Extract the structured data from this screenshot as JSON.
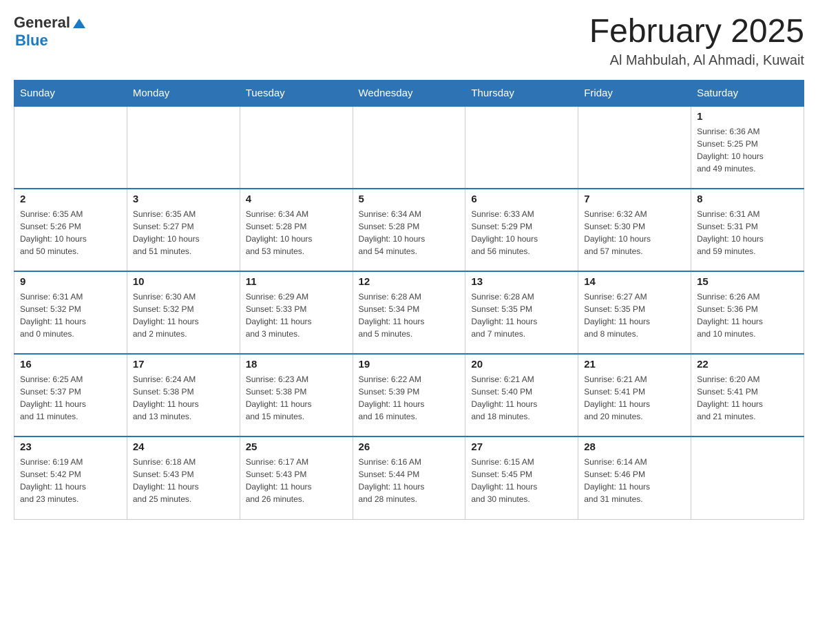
{
  "header": {
    "logo": {
      "general": "General",
      "blue": "Blue"
    },
    "title": "February 2025",
    "location": "Al Mahbulah, Al Ahmadi, Kuwait"
  },
  "days_of_week": [
    "Sunday",
    "Monday",
    "Tuesday",
    "Wednesday",
    "Thursday",
    "Friday",
    "Saturday"
  ],
  "weeks": [
    {
      "days": [
        {
          "number": "",
          "info": ""
        },
        {
          "number": "",
          "info": ""
        },
        {
          "number": "",
          "info": ""
        },
        {
          "number": "",
          "info": ""
        },
        {
          "number": "",
          "info": ""
        },
        {
          "number": "",
          "info": ""
        },
        {
          "number": "1",
          "info": "Sunrise: 6:36 AM\nSunset: 5:25 PM\nDaylight: 10 hours\nand 49 minutes."
        }
      ]
    },
    {
      "days": [
        {
          "number": "2",
          "info": "Sunrise: 6:35 AM\nSunset: 5:26 PM\nDaylight: 10 hours\nand 50 minutes."
        },
        {
          "number": "3",
          "info": "Sunrise: 6:35 AM\nSunset: 5:27 PM\nDaylight: 10 hours\nand 51 minutes."
        },
        {
          "number": "4",
          "info": "Sunrise: 6:34 AM\nSunset: 5:28 PM\nDaylight: 10 hours\nand 53 minutes."
        },
        {
          "number": "5",
          "info": "Sunrise: 6:34 AM\nSunset: 5:28 PM\nDaylight: 10 hours\nand 54 minutes."
        },
        {
          "number": "6",
          "info": "Sunrise: 6:33 AM\nSunset: 5:29 PM\nDaylight: 10 hours\nand 56 minutes."
        },
        {
          "number": "7",
          "info": "Sunrise: 6:32 AM\nSunset: 5:30 PM\nDaylight: 10 hours\nand 57 minutes."
        },
        {
          "number": "8",
          "info": "Sunrise: 6:31 AM\nSunset: 5:31 PM\nDaylight: 10 hours\nand 59 minutes."
        }
      ]
    },
    {
      "days": [
        {
          "number": "9",
          "info": "Sunrise: 6:31 AM\nSunset: 5:32 PM\nDaylight: 11 hours\nand 0 minutes."
        },
        {
          "number": "10",
          "info": "Sunrise: 6:30 AM\nSunset: 5:32 PM\nDaylight: 11 hours\nand 2 minutes."
        },
        {
          "number": "11",
          "info": "Sunrise: 6:29 AM\nSunset: 5:33 PM\nDaylight: 11 hours\nand 3 minutes."
        },
        {
          "number": "12",
          "info": "Sunrise: 6:28 AM\nSunset: 5:34 PM\nDaylight: 11 hours\nand 5 minutes."
        },
        {
          "number": "13",
          "info": "Sunrise: 6:28 AM\nSunset: 5:35 PM\nDaylight: 11 hours\nand 7 minutes."
        },
        {
          "number": "14",
          "info": "Sunrise: 6:27 AM\nSunset: 5:35 PM\nDaylight: 11 hours\nand 8 minutes."
        },
        {
          "number": "15",
          "info": "Sunrise: 6:26 AM\nSunset: 5:36 PM\nDaylight: 11 hours\nand 10 minutes."
        }
      ]
    },
    {
      "days": [
        {
          "number": "16",
          "info": "Sunrise: 6:25 AM\nSunset: 5:37 PM\nDaylight: 11 hours\nand 11 minutes."
        },
        {
          "number": "17",
          "info": "Sunrise: 6:24 AM\nSunset: 5:38 PM\nDaylight: 11 hours\nand 13 minutes."
        },
        {
          "number": "18",
          "info": "Sunrise: 6:23 AM\nSunset: 5:38 PM\nDaylight: 11 hours\nand 15 minutes."
        },
        {
          "number": "19",
          "info": "Sunrise: 6:22 AM\nSunset: 5:39 PM\nDaylight: 11 hours\nand 16 minutes."
        },
        {
          "number": "20",
          "info": "Sunrise: 6:21 AM\nSunset: 5:40 PM\nDaylight: 11 hours\nand 18 minutes."
        },
        {
          "number": "21",
          "info": "Sunrise: 6:21 AM\nSunset: 5:41 PM\nDaylight: 11 hours\nand 20 minutes."
        },
        {
          "number": "22",
          "info": "Sunrise: 6:20 AM\nSunset: 5:41 PM\nDaylight: 11 hours\nand 21 minutes."
        }
      ]
    },
    {
      "days": [
        {
          "number": "23",
          "info": "Sunrise: 6:19 AM\nSunset: 5:42 PM\nDaylight: 11 hours\nand 23 minutes."
        },
        {
          "number": "24",
          "info": "Sunrise: 6:18 AM\nSunset: 5:43 PM\nDaylight: 11 hours\nand 25 minutes."
        },
        {
          "number": "25",
          "info": "Sunrise: 6:17 AM\nSunset: 5:43 PM\nDaylight: 11 hours\nand 26 minutes."
        },
        {
          "number": "26",
          "info": "Sunrise: 6:16 AM\nSunset: 5:44 PM\nDaylight: 11 hours\nand 28 minutes."
        },
        {
          "number": "27",
          "info": "Sunrise: 6:15 AM\nSunset: 5:45 PM\nDaylight: 11 hours\nand 30 minutes."
        },
        {
          "number": "28",
          "info": "Sunrise: 6:14 AM\nSunset: 5:46 PM\nDaylight: 11 hours\nand 31 minutes."
        },
        {
          "number": "",
          "info": ""
        }
      ]
    }
  ]
}
